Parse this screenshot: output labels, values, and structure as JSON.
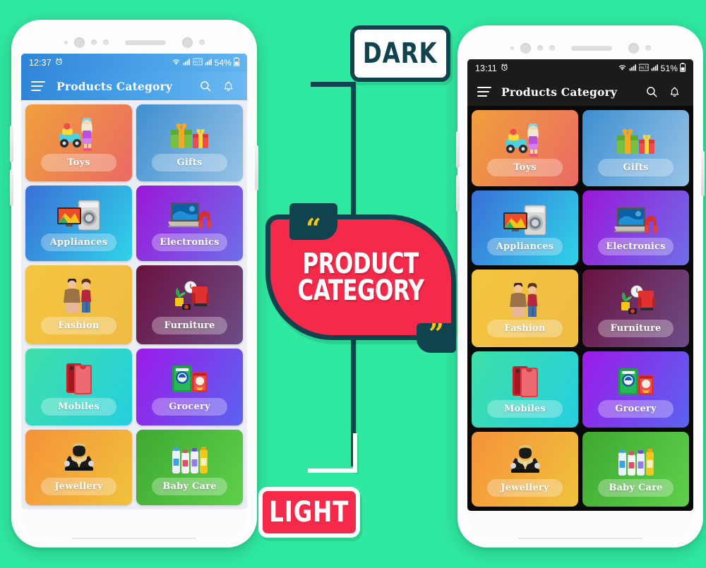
{
  "background_color": "#2fe9a0",
  "badge": {
    "line1": "PRODUCT",
    "line2": "CATEGORY",
    "open_quote": "“",
    "close_quote": "”",
    "fill_color": "#f5294a",
    "border_color": "#10434d",
    "quote_color": "#f5c518"
  },
  "labels": {
    "dark": "DARK",
    "light": "LIGHT"
  },
  "phones": [
    {
      "theme": "light",
      "statusbar": {
        "time": "12:37",
        "alarm_icon": "alarm-icon",
        "wifi_icon": "wifi-icon",
        "signal_icon": "signal-icon",
        "volte_icon": "volte-icon",
        "signal2_icon": "signal-icon",
        "battery": "54%",
        "battery_icon": "battery-icon",
        "bg_color": "#3d93e0"
      },
      "appbar": {
        "menu_icon": "hamburger-menu-icon",
        "title": "Products Category",
        "search_icon": "search-icon",
        "notification_icon": "bell-icon",
        "bg_color": "#4ba3e8"
      },
      "grid_bg": "#eceef5"
    },
    {
      "theme": "dark",
      "statusbar": {
        "time": "13:11",
        "alarm_icon": "alarm-icon",
        "wifi_icon": "wifi-icon",
        "signal_icon": "signal-icon",
        "volte_icon": "volte-icon",
        "signal2_icon": "signal-icon",
        "battery": "51%",
        "battery_icon": "battery-icon",
        "bg_color": "#1b1b1b"
      },
      "appbar": {
        "menu_icon": "hamburger-menu-icon",
        "title": "Products Category",
        "search_icon": "search-icon",
        "notification_icon": "bell-icon",
        "bg_color": "#1b1b1b"
      },
      "grid_bg": "#0a0a0a"
    }
  ],
  "categories": [
    {
      "label": "Toys",
      "icon": "toy-car-doll-icon",
      "gradient_from": "#f0a03c",
      "gradient_to": "#ea6a63"
    },
    {
      "label": "Gifts",
      "icon": "gift-boxes-icon",
      "gradient_from": "#3e8fd0",
      "gradient_to": "#97c3e6"
    },
    {
      "label": "Appliances",
      "icon": "washer-tv-icon",
      "gradient_from": "#3a6fd8",
      "gradient_to": "#2fd3e8"
    },
    {
      "label": "Electronics",
      "icon": "laptop-headphones-icon",
      "gradient_from": "#9a17d8",
      "gradient_to": "#6f6ee8"
    },
    {
      "label": "Fashion",
      "icon": "couple-clothing-icon",
      "gradient_from": "#f3c53f",
      "gradient_to": "#efbb45"
    },
    {
      "label": "Furniture",
      "icon": "armchair-plant-icon",
      "gradient_from": "#6b1140",
      "gradient_to": "#6c4d86"
    },
    {
      "label": "Mobiles",
      "icon": "smartphone-icon",
      "gradient_from": "#3fe0a8",
      "gradient_to": "#24cfe0"
    },
    {
      "label": "Grocery",
      "icon": "detergent-packs-icon",
      "gradient_from": "#9c1ae8",
      "gradient_to": "#5a63f0"
    },
    {
      "label": "Jewellery",
      "icon": "necklace-bust-icon",
      "gradient_from": "#f5923a",
      "gradient_to": "#f0c23c"
    },
    {
      "label": "Baby Care",
      "icon": "baby-bottles-icon",
      "gradient_from": "#3fa832",
      "gradient_to": "#5ed04a"
    }
  ]
}
